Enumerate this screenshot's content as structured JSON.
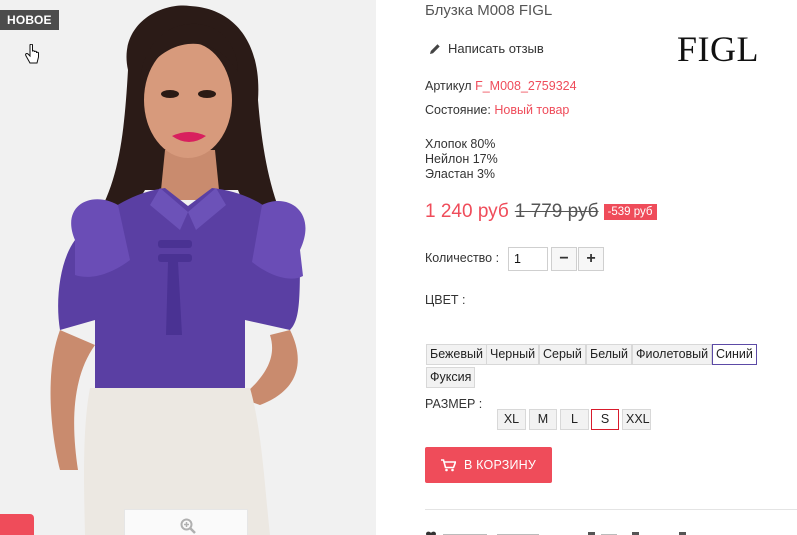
{
  "badge": {
    "new_label": "НОВОЕ"
  },
  "product": {
    "title": "Блузка M008 FIGL",
    "review_link": "Написать отзыв",
    "brand_logo": "FIGL",
    "sku_label": "Артикул",
    "sku_value": "F_M008_2759324",
    "condition_label": "Состояние:",
    "condition_value": "Новый товар",
    "composition": [
      "Хлопок 80%",
      "Нейлон 17%",
      "Эластан 3%"
    ]
  },
  "price": {
    "current": "1 240 руб",
    "old": "1 779 руб",
    "discount": "-539 руб"
  },
  "quantity": {
    "label": "Количество :",
    "value": "1",
    "minus_label": "−",
    "plus_label": "+"
  },
  "color": {
    "label": "ЦВЕТ :",
    "options": [
      "Бежевый",
      "Черный",
      "Серый",
      "Белый",
      "Фиолетовый",
      "Синий",
      "Фуксия"
    ],
    "selected": "Синий"
  },
  "size": {
    "label": "РАЗМЕР :",
    "options": [
      "XL",
      "M",
      "L",
      "S",
      "XXL"
    ],
    "selected": "S"
  },
  "cart": {
    "button_label": "В КОРЗИНУ"
  },
  "colors": {
    "accent": "#ef4c5a",
    "badge_bg": "#4c4c4c",
    "selected_color_border": "#5c4aa6",
    "selected_size_border": "#d81b2c"
  }
}
